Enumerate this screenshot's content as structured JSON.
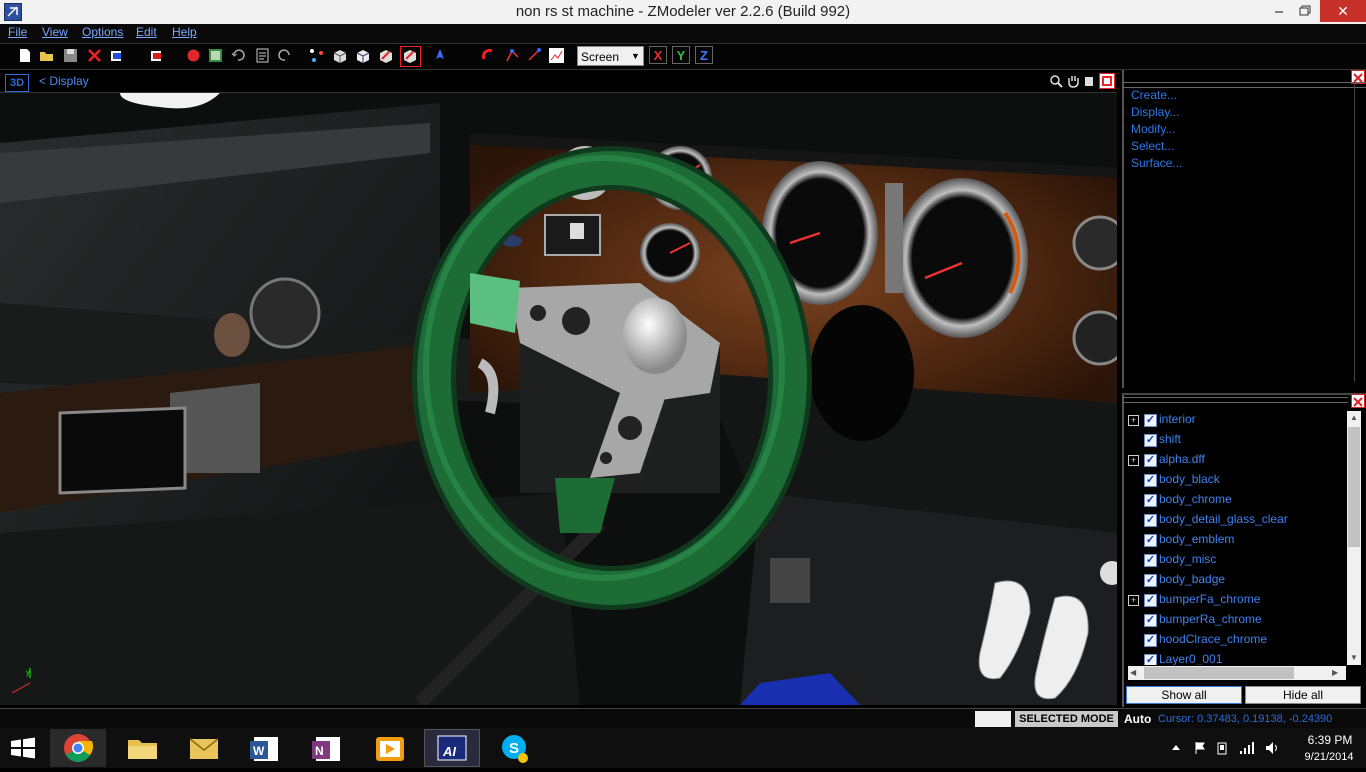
{
  "window": {
    "title": "non rs st machine - ZModeler ver 2.2.6 (Build 992)",
    "minimize_icon": "minimize-icon",
    "maximize_icon": "restore-icon",
    "close_glyph": "✕"
  },
  "menu": [
    "File",
    "View",
    "Options",
    "Edit",
    "Help"
  ],
  "toolbar": {
    "view_select": "Screen",
    "axis_x": "X",
    "axis_y": "Y",
    "axis_z": "Z"
  },
  "viewport": {
    "mode_badge": "3D",
    "breadcrumb": "<  Display"
  },
  "command_panel": {
    "links": [
      "Create...",
      "Display...",
      "Modify...",
      "Select...",
      "Surface..."
    ]
  },
  "object_tree": {
    "items": [
      {
        "label": "interior",
        "expandable": true
      },
      {
        "label": "shift",
        "expandable": false
      },
      {
        "label": "alpha.dff",
        "expandable": true
      },
      {
        "label": "body_black",
        "expandable": false
      },
      {
        "label": "body_chrome",
        "expandable": false
      },
      {
        "label": "body_detail_glass_clear",
        "expandable": false
      },
      {
        "label": "body_emblem",
        "expandable": false
      },
      {
        "label": "body_misc",
        "expandable": false
      },
      {
        "label": "body_badge",
        "expandable": false
      },
      {
        "label": "bumperFa_chrome",
        "expandable": true
      },
      {
        "label": "bumperRa_chrome",
        "expandable": false
      },
      {
        "label": "hoodClrace_chrome",
        "expandable": false
      },
      {
        "label": "Layer0_001",
        "expandable": false
      }
    ],
    "show_all": "Show all",
    "hide_all": "Hide all"
  },
  "statusbar": {
    "mode": "SELECTED MODE",
    "auto": "Auto",
    "cursor": "Cursor: 0.37483, 0.19138, -0.24390"
  },
  "taskbar": {
    "time": "6:39 PM",
    "date": "9/21/2014",
    "apps": [
      "chrome-icon",
      "file-explorer-icon",
      "outlook-icon",
      "word-icon",
      "onenote-icon",
      "media-player-icon",
      "asus-ai-icon",
      "skype-icon"
    ]
  },
  "colors": {
    "accent_blue": "#2e78e6",
    "close_red": "#c7312a",
    "steering_green": "#1d6b35"
  }
}
